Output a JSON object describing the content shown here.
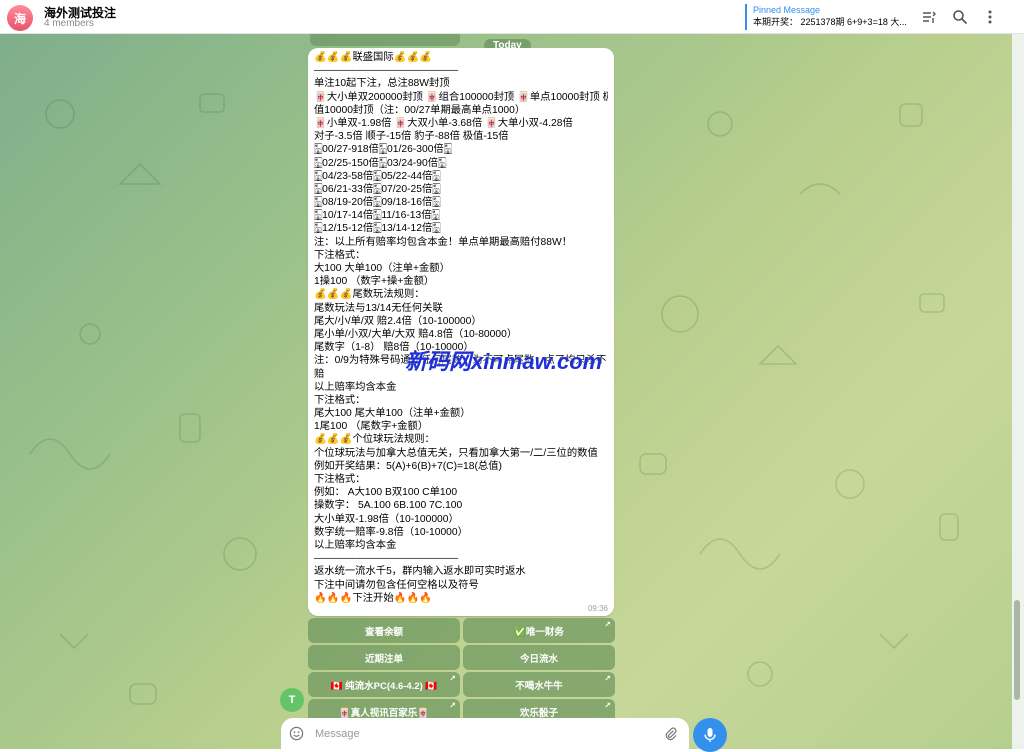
{
  "header": {
    "avatar_letter": "海",
    "title": "海外测试投注",
    "members": "4 members",
    "pinned_label": "Pinned Message",
    "pinned_text": "本期开奖： 2251378期 6+9+3=18 大..."
  },
  "date_chip": "Today",
  "message": {
    "lines": [
      "💰💰💰联盛国际💰💰💰",
      "——————————————",
      "单注10起下注，总注88W封顶",
      "🀄大小单双200000封顶 🀄组合100000封顶 🀄单点10000封顶 极",
      "值10000封顶（注：00/27单期最高单点1000）",
      "🀄小单双-1.98倍 🀄大双小单-3.68倍 🀄大单小双-4.28倍",
      "对子-3.5倍 顺子-15倍 豹子-88倍 极值-15倍",
      "🀣00/27-918倍🀣01/26-300倍🀣",
      "🀣02/25-150倍🀣03/24-90倍🀣",
      "🀣04/23-58倍🀣05/22-44倍🀣",
      "🀣06/21-33倍🀣07/20-25倍🀣",
      "🀣08/19-20倍🀣09/18-16倍🀣",
      "🀣10/17-14倍🀣11/16-13倍🀣",
      "🀣12/15-12倍🀣13/14-12倍🀣",
      "注：以上所有赔率均包含本金！单点单期最高赔付88W！",
      "下注格式：",
      "大100 大单100（注单+金额）",
      "1操100 （数字+操+金额）",
      "💰💰💰尾数玩法规则：",
      "尾数玩法与13/14无任何关联",
      "尾大/小/单/双  赔2.4倍（10-100000）",
      "尾小单/小双/大单/大双  赔4.8倍（10-80000）",
      "尾数字（1-8）  赔8倍（10-10000）",
      "注：0/9为特殊号码通吃任何尾数，为不可点尾数，点了均只杀不",
      "赔",
      "以上赔率均含本金",
      "下注格式：",
      "尾大100 尾大单100（注单+金额）",
      "1尾100 （尾数字+金额）",
      "💰💰💰个位球玩法规则：",
      "个位球玩法与加拿大总值无关，只看加拿大第一/二/三位的数值",
      "例如开奖结果：5(A)+6(B)+7(C)=18(总值)",
      "下注格式：",
      "例如：    A大100  B双100  C单100",
      "操数字：  5A.100  6B.100   7C.100",
      "大小单双-1.98倍（10-100000）",
      "数字统一赔率-9.8倍（10-10000）",
      "以上赔率均含本金",
      "——————————————",
      "返水统一流水千5，群内输入返水即可实时返水",
      "下注中间请勿包含任何空格以及符号",
      "🔥🔥🔥下注开始🔥🔥🔥"
    ],
    "time": "09:36"
  },
  "inline_buttons": [
    {
      "label": "查看余额",
      "link": false
    },
    {
      "label": "✅唯一财务",
      "link": true
    },
    {
      "label": "近期注单",
      "link": false
    },
    {
      "label": "今日流水",
      "link": false
    },
    {
      "label": "🇨🇦 纯流水PC(4.6-4.2) 🇨🇦",
      "link": true
    },
    {
      "label": "不喝水牛牛",
      "link": true
    },
    {
      "label": "🀄真人视讯百家乐🀄",
      "link": true
    },
    {
      "label": "欢乐骰子",
      "link": true
    }
  ],
  "sender_letter": "T",
  "composer": {
    "placeholder": "Message"
  },
  "watermark": "新码网xinmaw.com",
  "colors": {
    "accent": "#3390ec",
    "bubble": "#ffffff",
    "inline_button": "#5f8c55",
    "avatar_group": "#e8546c",
    "avatar_sender": "#65c468"
  },
  "icons": [
    "pinned-list-icon",
    "search-icon",
    "more-vertical-icon",
    "emoji-icon",
    "attach-icon",
    "mic-icon",
    "link-arrow-icon"
  ]
}
